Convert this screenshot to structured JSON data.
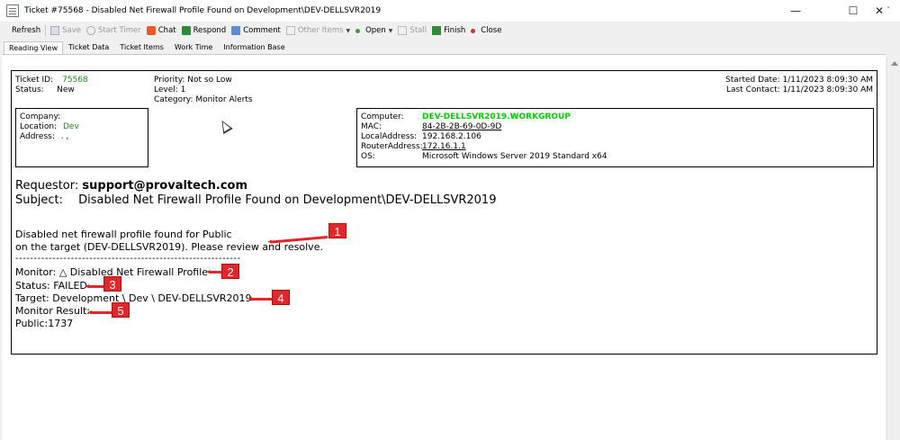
{
  "window": {
    "title": "Ticket #75568 - Disabled Net Firewall Profile Found on Development\\DEV-DELLSVR2019",
    "controls": {
      "minimize": "—",
      "maximize": "☐",
      "close": "✕"
    }
  },
  "toolbar": {
    "refresh": "Refresh",
    "save": "Save",
    "start_timer": "Start Timer",
    "chat": "Chat",
    "respond": "Respond",
    "comment": "Comment",
    "other_items": "Other Items",
    "open": "Open",
    "stall": "Stall",
    "finish": "Finish",
    "close": "Close"
  },
  "tabs": [
    "Reading View",
    "Ticket Data",
    "Ticket Items",
    "Work Time",
    "Information Base"
  ],
  "ticket": {
    "id_label": "Ticket ID:",
    "id": "75568",
    "status_label": "Status:",
    "status": "New",
    "priority_label": "Priority:",
    "priority": "Not so Low",
    "level_label": "Level:",
    "level": "1",
    "category_label": "Category:",
    "category": "Monitor Alerts",
    "started_label": "Started Date:",
    "started": "1/11/2023 8:09:30 AM",
    "last_contact_label": "Last Contact:",
    "last_contact": "1/11/2023 8:09:30 AM"
  },
  "company": {
    "company_label": "Company:",
    "company": "",
    "location_label": "Location:",
    "location": "Dev",
    "address_label": "Address:",
    "address": ". ,"
  },
  "computer": {
    "computer_label": "Computer:",
    "computer": "DEV-DELLSVR2019.WORKGROUP",
    "mac_label": "MAC:",
    "mac": "84-2B-2B-69-0D-9D",
    "local_label": "LocalAddress:",
    "local": "192.168.2.106",
    "router_label": "RouterAddress:",
    "router": "172.16.1.1",
    "os_label": "OS:",
    "os": "Microsoft Windows Server 2019 Standard x64"
  },
  "message": {
    "requestor_label": "Requestor:",
    "requestor": "support@provaltech.com",
    "subject_label": "Subject:",
    "subject": "Disabled Net Firewall Profile Found on Development\\DEV-DELLSVR2019",
    "line1": " Disabled net firewall profile found for Public",
    "line2": "on the target (DEV-DELLSVR2019). Please review and resolve.",
    "divider": "-------------------------------------------------------------",
    "monitor": "Monitor: △ Disabled Net Firewall Profile",
    "status": "Status: FAILED",
    "target": "Target: Development \\ Dev \\ DEV-DELLSVR2019",
    "result": "Monitor Result:",
    "public": "Public:1737"
  },
  "callouts": [
    "1",
    "2",
    "3",
    "4",
    "5"
  ],
  "colors": {
    "callout": "#e0282c",
    "green": "#1a8a1a",
    "computer_green": "#00d000"
  }
}
